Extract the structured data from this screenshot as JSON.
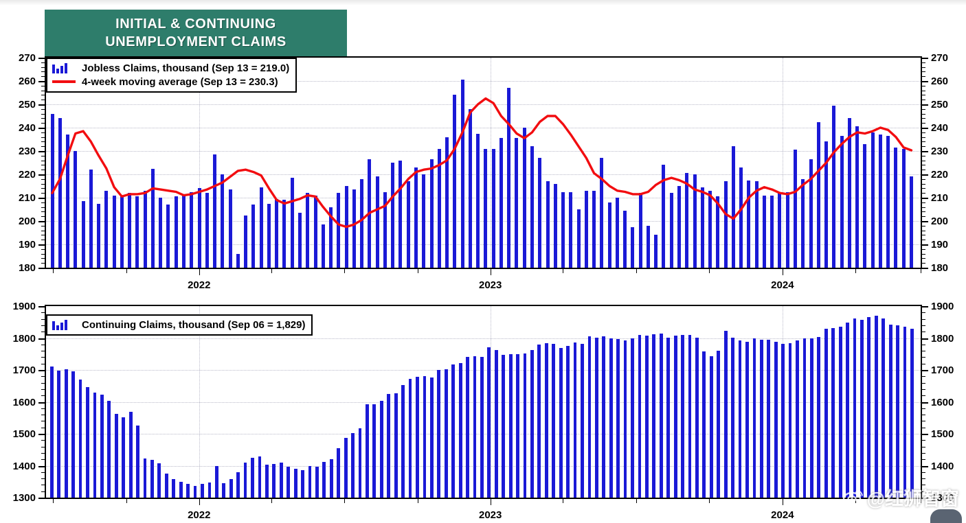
{
  "title": {
    "line1": "INITIAL & CONTINUING",
    "line2": "UNEMPLOYMENT CLAIMS",
    "banner_color": "#2e7d6b"
  },
  "watermark": {
    "text": "@红狮智窗",
    "icon": "weibo-eye-icon"
  },
  "colors": {
    "bar": "#1a19d6",
    "line": "#f20d10",
    "grid": "#b9b9c9",
    "frame": "#000000"
  },
  "chart_data": [
    {
      "id": "initial-claims",
      "type": "bar",
      "title": "INITIAL & CONTINUING UNEMPLOYMENT CLAIMS",
      "xlabel": "",
      "ylabel": "",
      "ylim": [
        180,
        270
      ],
      "yticks": [
        180,
        190,
        200,
        210,
        220,
        230,
        240,
        250,
        260,
        270
      ],
      "grid": true,
      "legend_position": "top-left",
      "xtick_labels": [
        "2022",
        "2023",
        "2024"
      ],
      "xtick_positions": [
        0.175,
        0.508,
        0.842
      ],
      "xminor_positions": [
        0.008,
        0.092,
        0.258,
        0.341,
        0.425,
        0.591,
        0.675,
        0.758,
        0.925,
        1.0
      ],
      "legend": [
        {
          "marker": "bars",
          "label": "Jobless Claims, thousand (Sep 13 = 219.0)"
        },
        {
          "marker": "line",
          "label": "4-week moving average (Sep 13 = 230.3)"
        }
      ],
      "series": [
        {
          "name": "Jobless Claims, thousand",
          "marker": "bars",
          "values": [
            246,
            244,
            237,
            230,
            208.5,
            222,
            207.5,
            213,
            211,
            211,
            212,
            210.5,
            213,
            222.5,
            210,
            207,
            210.5,
            211,
            212.5,
            214,
            212,
            228.5,
            220,
            213.5,
            186,
            202.5,
            207,
            214.5,
            207.5,
            209.5,
            209,
            218.5,
            203.5,
            212,
            211,
            198.5,
            206,
            212,
            215,
            213.5,
            218,
            226.5,
            219,
            212.5,
            225,
            226,
            217,
            223,
            220,
            226.5,
            231,
            236,
            254,
            260.5,
            248,
            237.5,
            231,
            231,
            235.5,
            257,
            235.5,
            240,
            232,
            227,
            217,
            216,
            212.5,
            212.5,
            205,
            213,
            213,
            227,
            208,
            210,
            204.5,
            197.5,
            212,
            198,
            194,
            224,
            212,
            215,
            220.5,
            220,
            214.5,
            213,
            210.5,
            217,
            232,
            223,
            217.5,
            217,
            211,
            211,
            212.5,
            212.5,
            230.5,
            218,
            226.5,
            242.5,
            234,
            249.5,
            236.5,
            244,
            240.5,
            233,
            238,
            237,
            236.5,
            231.5,
            231,
            219
          ]
        },
        {
          "name": "4-week moving average",
          "marker": "line",
          "values": [
            212,
            218,
            228,
            237.5,
            238.5,
            234,
            228,
            222.5,
            214.5,
            210.5,
            211.5,
            211.5,
            212,
            214,
            213.5,
            213,
            212.5,
            211,
            211.5,
            212.5,
            213.5,
            215,
            216.5,
            219,
            221.5,
            222,
            221,
            219.5,
            214,
            209,
            207.5,
            208.5,
            209.5,
            211,
            210.5,
            206,
            202,
            198.5,
            197.5,
            198.5,
            200.5,
            203.5,
            205,
            206.5,
            210.5,
            214,
            218,
            221,
            222,
            222.5,
            224,
            226,
            231,
            238,
            246.5,
            250,
            252.5,
            250.5,
            245,
            241.5,
            237.5,
            235.5,
            238,
            242.5,
            245,
            245,
            241.5,
            237,
            232,
            227,
            220.5,
            218,
            215,
            213,
            212.5,
            211.5,
            211.5,
            212.5,
            215.5,
            217.5,
            218.5,
            217.5,
            216,
            213.5,
            212.5,
            211,
            207.5,
            203,
            201,
            205,
            210,
            213,
            214.5,
            213.5,
            212,
            211.5,
            212.5,
            215.5,
            218,
            221.5,
            225,
            229.5,
            233,
            236,
            238,
            237.5,
            238.5,
            240,
            239,
            236,
            231.5,
            230.3
          ]
        }
      ]
    },
    {
      "id": "continuing-claims",
      "type": "bar",
      "title": "Continuing Claims",
      "xlabel": "",
      "ylabel": "",
      "ylim": [
        1300,
        1900
      ],
      "yticks": [
        1300,
        1400,
        1500,
        1600,
        1700,
        1800,
        1900
      ],
      "grid": true,
      "legend_position": "top-left",
      "xtick_labels": [
        "2022",
        "2023",
        "2024"
      ],
      "xtick_positions": [
        0.175,
        0.508,
        0.842
      ],
      "xminor_positions": [
        0.008,
        0.092,
        0.258,
        0.341,
        0.425,
        0.591,
        0.675,
        0.758,
        0.925,
        1.0
      ],
      "legend": [
        {
          "marker": "bars",
          "label": "Continuing Claims, thousand (Sep 06 = 1,829)"
        }
      ],
      "series": [
        {
          "name": "Continuing Claims, thousand",
          "marker": "bars",
          "values": [
            1710,
            1697,
            1703,
            1696,
            1670,
            1646,
            1628,
            1623,
            1604,
            1562,
            1552,
            1569,
            1525,
            1422,
            1418,
            1408,
            1375,
            1358,
            1350,
            1344,
            1337,
            1344,
            1348,
            1399,
            1345,
            1358,
            1379,
            1410,
            1425,
            1428,
            1403,
            1406,
            1410,
            1396,
            1391,
            1387,
            1398,
            1397,
            1412,
            1420,
            1454,
            1488,
            1503,
            1518,
            1593,
            1592,
            1604,
            1625,
            1627,
            1652,
            1672,
            1679,
            1681,
            1676,
            1700,
            1702,
            1718,
            1722,
            1740,
            1744,
            1740,
            1770,
            1762,
            1747,
            1749,
            1750,
            1752,
            1763,
            1780,
            1784,
            1781,
            1768,
            1775,
            1785,
            1782,
            1806,
            1801,
            1806,
            1800,
            1797,
            1792,
            1800,
            1810,
            1807,
            1812,
            1815,
            1801,
            1808,
            1810,
            1809,
            1801,
            1758,
            1742,
            1760,
            1822,
            1801,
            1793,
            1788,
            1798,
            1795,
            1795,
            1788,
            1781,
            1784,
            1793,
            1798,
            1799,
            1803,
            1828,
            1831,
            1836,
            1848,
            1862,
            1858,
            1866,
            1869,
            1862,
            1843,
            1840,
            1836,
            1829
          ]
        }
      ]
    }
  ]
}
